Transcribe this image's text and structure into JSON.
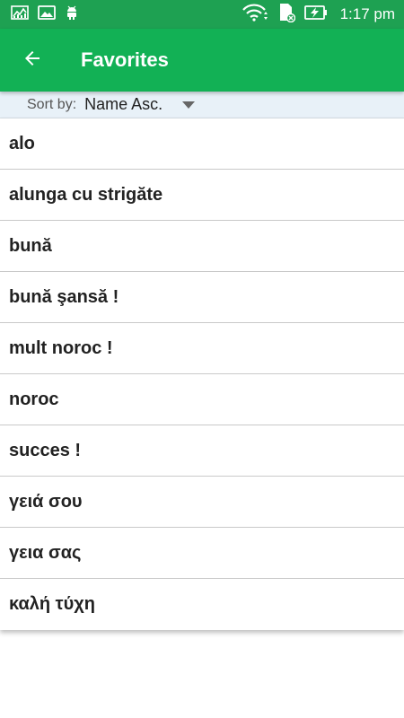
{
  "status_bar": {
    "time": "1:17 pm",
    "icons": [
      "chart-notification-icon",
      "image-notification-icon",
      "android-icon",
      "wifi-icon",
      "sim-card-icon",
      "battery-charging-icon"
    ]
  },
  "app_bar": {
    "title": "Favorites",
    "back_icon": "arrow-back-icon"
  },
  "sort": {
    "label": "Sort by:",
    "value": "Name Asc."
  },
  "favorites": [
    "alo",
    "alunga cu strigăte",
    "bună",
    "bună şansă !",
    "mult noroc !",
    "noroc",
    "succes !",
    "γειά σου",
    "γεια σας",
    "καλή τύχη"
  ],
  "colors": {
    "status_bar": "#1ea152",
    "app_bar": "#12b155",
    "sort_bar": "#e8f1f8"
  }
}
